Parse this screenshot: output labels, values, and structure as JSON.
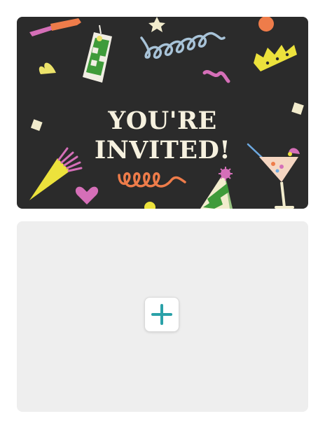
{
  "invitation_card": {
    "title_line1": "YOU'RE",
    "title_line2": "INVITED!",
    "background_color": "#2b2b2b",
    "text_color": "#f6f1df"
  },
  "add_panel": {
    "background_color": "#eeeeee",
    "add_icon_color": "#2aa1a8",
    "add_icon": "plus-icon"
  }
}
